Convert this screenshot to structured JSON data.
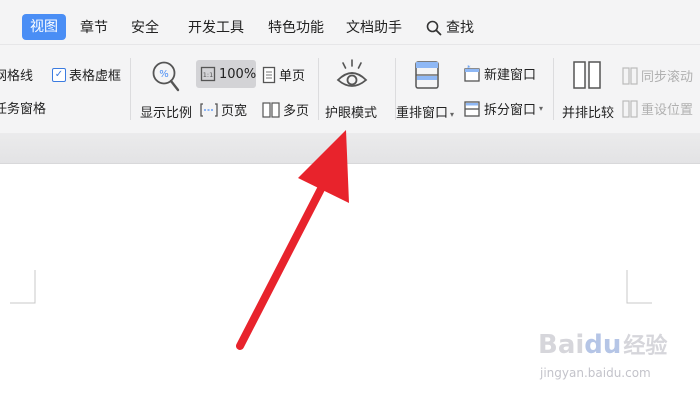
{
  "tabs": [
    {
      "label": "视图",
      "active": true
    },
    {
      "label": "章节",
      "active": false
    },
    {
      "label": "安全",
      "active": false
    },
    {
      "label": "开发工具",
      "active": false
    },
    {
      "label": "特色功能",
      "active": false
    },
    {
      "label": "文档助手",
      "active": false
    }
  ],
  "search_label": "查找",
  "ribbon": {
    "gridlines_label": "网格线",
    "table_gridlines_label": "表格虚框",
    "task_pane_label": "任务窗格",
    "zoom_label": "显示比例",
    "zoom_100_label": "100%",
    "single_page_label": "单页",
    "page_width_label": "页宽",
    "multi_page_label": "多页",
    "eye_mode_label": "护眼模式",
    "arrange_windows_label": "重排窗口",
    "new_window_label": "新建窗口",
    "split_window_label": "拆分窗口",
    "side_by_side_label": "并排比较",
    "sync_scroll_label": "同步滚动",
    "reset_position_label": "重设位置"
  },
  "watermark": {
    "brand": "Bai",
    "brand_suffix": "经验",
    "url": "jingyan.baidu.com"
  },
  "colors": {
    "accent": "#4a8ef5",
    "arrow": "#e8232c",
    "ribbon_bg": "#f4f4f5"
  }
}
